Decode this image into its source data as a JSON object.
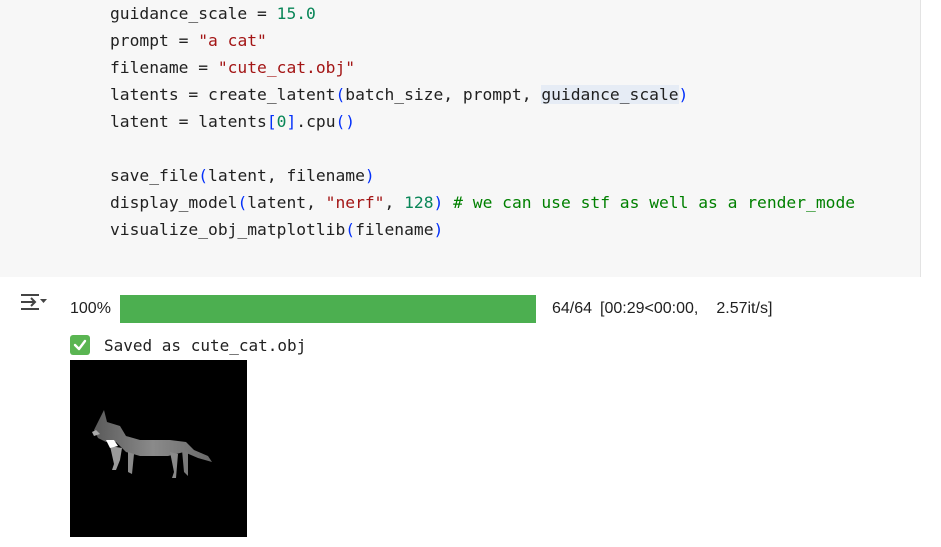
{
  "code_lines": [
    {
      "parts": [
        {
          "t": "guidance_scale = "
        },
        {
          "t": "15.0",
          "c": "num"
        }
      ]
    },
    {
      "parts": [
        {
          "t": "prompt = "
        },
        {
          "t": "\"a cat\"",
          "c": "str"
        }
      ]
    },
    {
      "parts": [
        {
          "t": "filename = "
        },
        {
          "t": "\"cute_cat.obj\"",
          "c": "str"
        }
      ]
    },
    {
      "parts": [
        {
          "t": "latents = create_latent"
        },
        {
          "t": "(",
          "c": "br"
        },
        {
          "t": "batch_size, prompt, "
        },
        {
          "t": "guidance_scale",
          "c": "hl"
        },
        {
          "t": ")",
          "c": "br"
        }
      ]
    },
    {
      "parts": [
        {
          "t": "latent = latents"
        },
        {
          "t": "[",
          "c": "br"
        },
        {
          "t": "0",
          "c": "num"
        },
        {
          "t": "]",
          "c": "br"
        },
        {
          "t": ".cpu"
        },
        {
          "t": "()",
          "c": "br"
        }
      ]
    },
    {
      "parts": [
        {
          "t": ""
        }
      ]
    },
    {
      "parts": [
        {
          "t": "save_file"
        },
        {
          "t": "(",
          "c": "br"
        },
        {
          "t": "latent, filename"
        },
        {
          "t": ")",
          "c": "br"
        }
      ]
    },
    {
      "parts": [
        {
          "t": "display_model"
        },
        {
          "t": "(",
          "c": "br"
        },
        {
          "t": "latent, "
        },
        {
          "t": "\"nerf\"",
          "c": "str"
        },
        {
          "t": ", "
        },
        {
          "t": "128",
          "c": "num"
        },
        {
          "t": ")",
          "c": "br"
        },
        {
          "t": " "
        },
        {
          "t": "# we can use stf as well as a render_mode",
          "c": "com"
        }
      ]
    },
    {
      "parts": [
        {
          "t": "visualize_obj_matplotlib"
        },
        {
          "t": "(",
          "c": "br"
        },
        {
          "t": "filename"
        },
        {
          "t": ")",
          "c": "br"
        }
      ]
    }
  ],
  "output": {
    "progress": {
      "percent_label": "100%",
      "fraction": 1.0,
      "count": "64/64",
      "time": "[00:29<00:00,",
      "rate": "2.57it/s]",
      "bar_color": "#4caf50"
    },
    "saved_message": "Saved as cute_cat.obj",
    "check_icon": "white-check-mark-icon",
    "output_icon": "output-toggle-icon"
  },
  "colors": {
    "number": "#098658",
    "string": "#a31515",
    "comment": "#008000",
    "bracket": "#0431fa",
    "check_bg": "#5ab552"
  }
}
